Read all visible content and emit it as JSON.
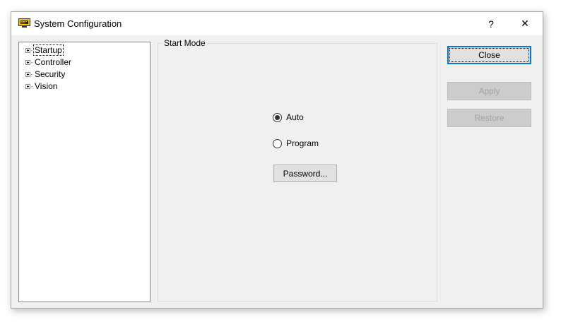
{
  "window": {
    "title": "System Configuration"
  },
  "titlebar": {
    "help_glyph": "?",
    "close_glyph": "✕"
  },
  "tree": {
    "items": [
      {
        "label": "Startup"
      },
      {
        "label": "Controller"
      },
      {
        "label": "Security"
      },
      {
        "label": "Vision"
      }
    ]
  },
  "start_mode": {
    "title": "Start Mode",
    "options": [
      {
        "label": "Auto",
        "checked": true
      },
      {
        "label": "Program",
        "checked": false
      }
    ],
    "password_label": "Password..."
  },
  "buttons": {
    "close": "Close",
    "apply": "Apply",
    "restore": "Restore"
  },
  "colors": {
    "accent": "#0078d7",
    "window_bg": "#f0f0f0",
    "disabled_button_bg": "#cccccc"
  },
  "icons": {
    "app": "monitor-terminal-icon",
    "expander": "plus-box-icon",
    "radio": "radio-button-icon"
  }
}
